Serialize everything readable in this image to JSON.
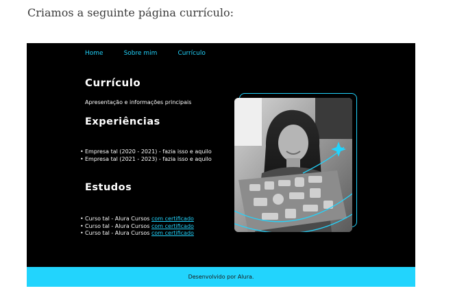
{
  "intro_text": "Criamos a seguinte página currículo:",
  "page": {
    "nav": [
      "Home",
      "Sobre mim",
      "Currículo"
    ],
    "title": "Currículo",
    "subtitle": "Apresentação e informações principais",
    "experiences_title": "Experiências",
    "experiences": [
      "Empresa tal (2020 - 2021) - fazia isso e aquilo",
      "Empresa tal (2021 - 2023) - fazia isso e aquilo"
    ],
    "studies_title": "Estudos",
    "studies": [
      {
        "text": "Curso tal - Alura Cursos ",
        "link": "com certificado"
      },
      {
        "text": "Curso tal - Alura Cursos ",
        "link": "com certificado"
      },
      {
        "text": "Curso tal - Alura Cursos ",
        "link": "com certificado"
      }
    ],
    "footer": "Desenvolvido por Alura."
  },
  "colors": {
    "accent": "#22d4fd",
    "background": "#000000",
    "footer_bg": "#22d4fd"
  }
}
